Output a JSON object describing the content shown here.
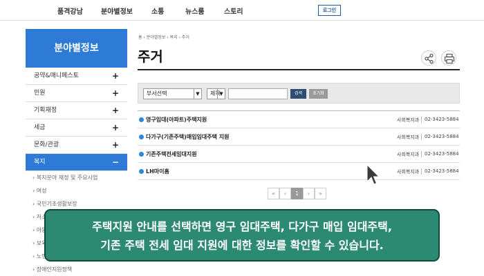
{
  "topnav": {
    "items": [
      "품격강남",
      "분야별정보",
      "소통",
      "뉴스룸",
      "스토리"
    ],
    "login": "로그인"
  },
  "sidebar": {
    "title": "분야별정보",
    "items": [
      {
        "label": "공약&매니페스토",
        "toggle": "+"
      },
      {
        "label": "민원",
        "toggle": "+"
      },
      {
        "label": "기획재정",
        "toggle": "+"
      },
      {
        "label": "세금",
        "toggle": "+"
      },
      {
        "label": "문화/관광",
        "toggle": "+"
      },
      {
        "label": "복지",
        "toggle": "−"
      }
    ],
    "subitems": [
      "› 복지분야 재정 및 주요사업",
      "› 여성",
      "› 국민기초생활보장",
      "› 저소득층",
      "› 아동",
      "› 보육",
      "› 노인",
      "› 장애인지원정책"
    ]
  },
  "breadcrumb": "홈  ›  분야별정보  ›  복지  ›  주거",
  "page_title": "주거",
  "icons": {
    "share": "share-icon",
    "print": "print-icon"
  },
  "search": {
    "dept_select": "부서선택",
    "field_select": "제목",
    "keyword": "",
    "search_label": "검색",
    "reset_label": "초기화"
  },
  "list": [
    {
      "title": "영구임대(아파트)주택지원",
      "dept": "사회복지과",
      "phone": "02-3423-5884"
    },
    {
      "title": "다가구(기존주택)매입임대주택 지원",
      "dept": "사회복지과",
      "phone": "02-3423-5884"
    },
    {
      "title": "기존주택전세임대지원",
      "dept": "사회복지과",
      "phone": "02-3423-5884"
    },
    {
      "title": "LH마이홈",
      "dept": "사회복지과",
      "phone": "02-3423-5884"
    }
  ],
  "pager": {
    "first": "«",
    "prev": "‹",
    "current": "1",
    "next": "›",
    "last": "»"
  },
  "caption": {
    "line1": "주택지원 안내를 선택하면 영구 임대주택, 다가구 매입 임대주택,",
    "line2": "기존 주택 전세 임대 지원에 대한 정보를 확인할 수 있습니다."
  },
  "colors": {
    "accent": "#2d7bd6",
    "caption_bg": "#2c8a72",
    "search_btn": "#2f4d70"
  }
}
